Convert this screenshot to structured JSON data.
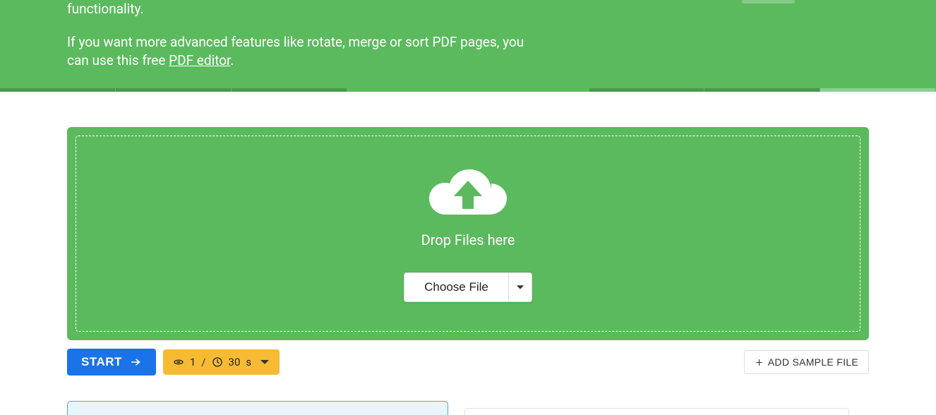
{
  "hero": {
    "line1_suffix": "functionality.",
    "advanced_prefix": "If you want more advanced features like rotate, merge or sort PDF pages, you can use this free ",
    "advanced_link": "PDF editor",
    "advanced_suffix": "."
  },
  "dropzone": {
    "label": "Drop Files here",
    "choose_file": "Choose File"
  },
  "actions": {
    "start": "START",
    "count": "1",
    "separator": "/",
    "duration": "30",
    "unit": "s",
    "add_sample": "ADD SAMPLE FILE"
  }
}
